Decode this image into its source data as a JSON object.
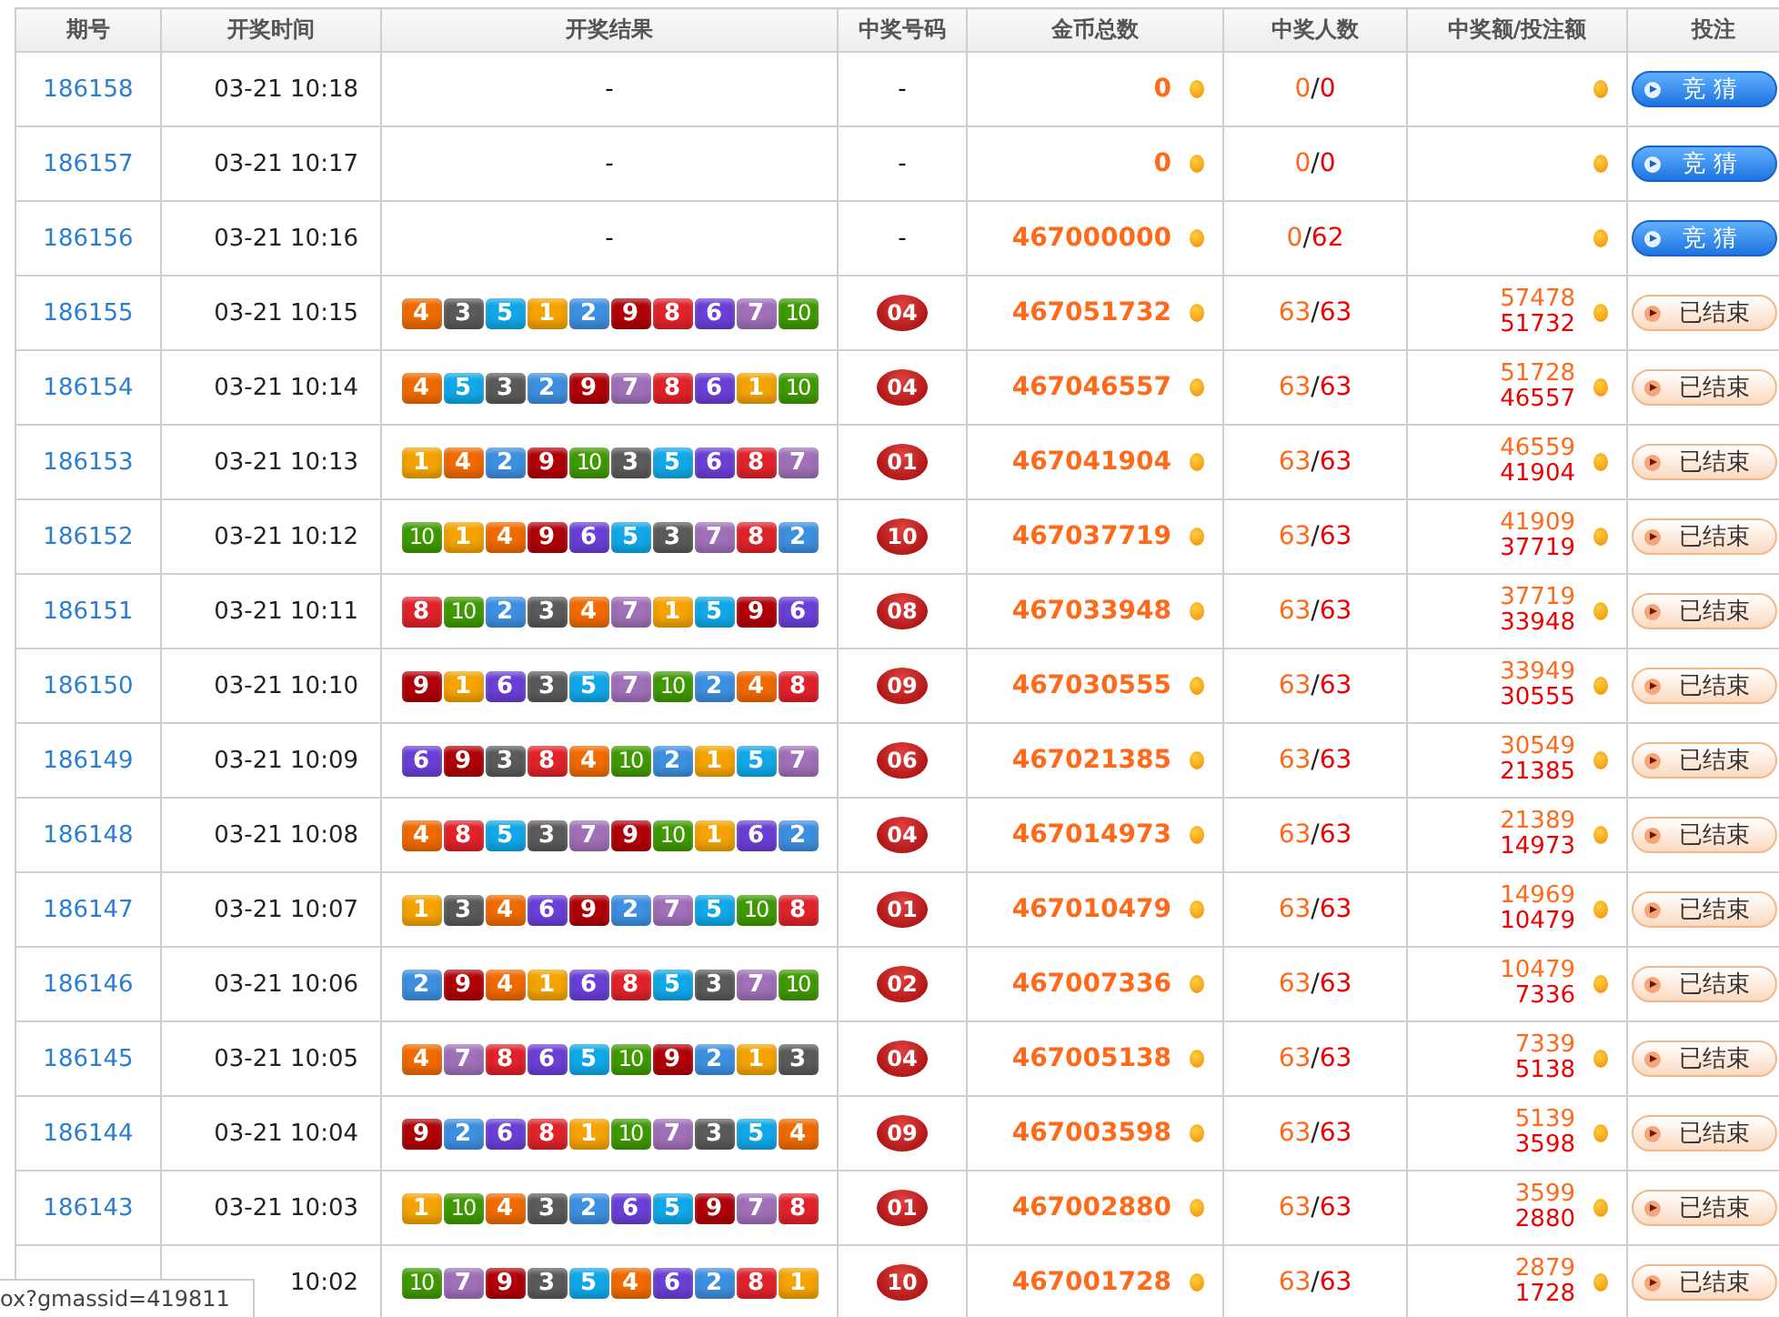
{
  "table": {
    "columns": [
      "期号",
      "开奖时间",
      "开奖结果",
      "中奖号码",
      "金币总数",
      "中奖人数",
      "中奖额/投注额",
      "投注"
    ],
    "rows": [
      {
        "issue": "186158",
        "time": "03-21 10:18",
        "result": "-",
        "balls": [],
        "winning": "-",
        "coins": "0",
        "winners": "0",
        "sep": "/",
        "bettors": "0",
        "action": {
          "kind": "bet",
          "label": "竞 猜"
        }
      },
      {
        "issue": "186157",
        "time": "03-21 10:17",
        "result": "-",
        "balls": [],
        "winning": "-",
        "coins": "0",
        "winners": "0",
        "sep": "/",
        "bettors": "0",
        "action": {
          "kind": "bet",
          "label": "竞 猜"
        }
      },
      {
        "issue": "186156",
        "time": "03-21 10:16",
        "result": "-",
        "balls": [],
        "winning": "-",
        "coins": "467000000",
        "winners": "0",
        "sep": "/",
        "bettors": "62",
        "action": {
          "kind": "bet",
          "label": "竞 猜"
        }
      },
      {
        "issue": "186155",
        "time": "03-21 10:15",
        "balls": [
          "4",
          "3",
          "5",
          "1",
          "2",
          "9",
          "8",
          "6",
          "7",
          "10"
        ],
        "winning_ball": "04",
        "coins": "467051732",
        "winners": "63",
        "sep": "/",
        "bettors": "63",
        "prize": "57478",
        "stake": "51732",
        "action": {
          "kind": "ended",
          "label": "已结束"
        }
      },
      {
        "issue": "186154",
        "time": "03-21 10:14",
        "balls": [
          "4",
          "5",
          "3",
          "2",
          "9",
          "7",
          "8",
          "6",
          "1",
          "10"
        ],
        "winning_ball": "04",
        "coins": "467046557",
        "winners": "63",
        "sep": "/",
        "bettors": "63",
        "prize": "51728",
        "stake": "46557",
        "action": {
          "kind": "ended",
          "label": "已结束"
        }
      },
      {
        "issue": "186153",
        "time": "03-21 10:13",
        "balls": [
          "1",
          "4",
          "2",
          "9",
          "10",
          "3",
          "5",
          "6",
          "8",
          "7"
        ],
        "winning_ball": "01",
        "coins": "467041904",
        "winners": "63",
        "sep": "/",
        "bettors": "63",
        "prize": "46559",
        "stake": "41904",
        "action": {
          "kind": "ended",
          "label": "已结束"
        }
      },
      {
        "issue": "186152",
        "time": "03-21 10:12",
        "balls": [
          "10",
          "1",
          "4",
          "9",
          "6",
          "5",
          "3",
          "7",
          "8",
          "2"
        ],
        "winning_ball": "10",
        "coins": "467037719",
        "winners": "63",
        "sep": "/",
        "bettors": "63",
        "prize": "41909",
        "stake": "37719",
        "action": {
          "kind": "ended",
          "label": "已结束"
        }
      },
      {
        "issue": "186151",
        "time": "03-21 10:11",
        "balls": [
          "8",
          "10",
          "2",
          "3",
          "4",
          "7",
          "1",
          "5",
          "9",
          "6"
        ],
        "winning_ball": "08",
        "coins": "467033948",
        "winners": "63",
        "sep": "/",
        "bettors": "63",
        "prize": "37719",
        "stake": "33948",
        "action": {
          "kind": "ended",
          "label": "已结束"
        }
      },
      {
        "issue": "186150",
        "time": "03-21 10:10",
        "balls": [
          "9",
          "1",
          "6",
          "3",
          "5",
          "7",
          "10",
          "2",
          "4",
          "8"
        ],
        "winning_ball": "09",
        "coins": "467030555",
        "winners": "63",
        "sep": "/",
        "bettors": "63",
        "prize": "33949",
        "stake": "30555",
        "action": {
          "kind": "ended",
          "label": "已结束"
        }
      },
      {
        "issue": "186149",
        "time": "03-21 10:09",
        "balls": [
          "6",
          "9",
          "3",
          "8",
          "4",
          "10",
          "2",
          "1",
          "5",
          "7"
        ],
        "winning_ball": "06",
        "coins": "467021385",
        "winners": "63",
        "sep": "/",
        "bettors": "63",
        "prize": "30549",
        "stake": "21385",
        "action": {
          "kind": "ended",
          "label": "已结束"
        }
      },
      {
        "issue": "186148",
        "time": "03-21 10:08",
        "balls": [
          "4",
          "8",
          "5",
          "3",
          "7",
          "9",
          "10",
          "1",
          "6",
          "2"
        ],
        "winning_ball": "04",
        "coins": "467014973",
        "winners": "63",
        "sep": "/",
        "bettors": "63",
        "prize": "21389",
        "stake": "14973",
        "action": {
          "kind": "ended",
          "label": "已结束"
        }
      },
      {
        "issue": "186147",
        "time": "03-21 10:07",
        "balls": [
          "1",
          "3",
          "4",
          "6",
          "9",
          "2",
          "7",
          "5",
          "10",
          "8"
        ],
        "winning_ball": "01",
        "coins": "467010479",
        "winners": "63",
        "sep": "/",
        "bettors": "63",
        "prize": "14969",
        "stake": "10479",
        "action": {
          "kind": "ended",
          "label": "已结束"
        }
      },
      {
        "issue": "186146",
        "time": "03-21 10:06",
        "balls": [
          "2",
          "9",
          "4",
          "1",
          "6",
          "8",
          "5",
          "3",
          "7",
          "10"
        ],
        "winning_ball": "02",
        "coins": "467007336",
        "winners": "63",
        "sep": "/",
        "bettors": "63",
        "prize": "10479",
        "stake": "7336",
        "action": {
          "kind": "ended",
          "label": "已结束"
        }
      },
      {
        "issue": "186145",
        "time": "03-21 10:05",
        "balls": [
          "4",
          "7",
          "8",
          "6",
          "5",
          "10",
          "9",
          "2",
          "1",
          "3"
        ],
        "winning_ball": "04",
        "coins": "467005138",
        "winners": "63",
        "sep": "/",
        "bettors": "63",
        "prize": "7339",
        "stake": "5138",
        "action": {
          "kind": "ended",
          "label": "已结束"
        }
      },
      {
        "issue": "186144",
        "time": "03-21 10:04",
        "balls": [
          "9",
          "2",
          "6",
          "8",
          "1",
          "10",
          "7",
          "3",
          "5",
          "4"
        ],
        "winning_ball": "09",
        "coins": "467003598",
        "winners": "63",
        "sep": "/",
        "bettors": "63",
        "prize": "5139",
        "stake": "3598",
        "action": {
          "kind": "ended",
          "label": "已结束"
        }
      },
      {
        "issue": "186143",
        "time": "03-21 10:03",
        "balls": [
          "1",
          "10",
          "4",
          "3",
          "2",
          "6",
          "5",
          "9",
          "7",
          "8"
        ],
        "winning_ball": "01",
        "coins": "467002880",
        "winners": "63",
        "sep": "/",
        "bettors": "63",
        "prize": "3599",
        "stake": "2880",
        "action": {
          "kind": "ended",
          "label": "已结束"
        }
      },
      {
        "time": "10:02",
        "balls": [
          "10",
          "7",
          "9",
          "3",
          "5",
          "4",
          "6",
          "2",
          "8",
          "1"
        ],
        "winning_ball": "10",
        "coins": "467001728",
        "winners": "63",
        "sep": "/",
        "bettors": "63",
        "prize": "2879",
        "stake": "1728",
        "action": {
          "kind": "ended",
          "label": "已结束"
        }
      }
    ]
  },
  "status_bar": {
    "url": "ox?gmassid=419811"
  }
}
